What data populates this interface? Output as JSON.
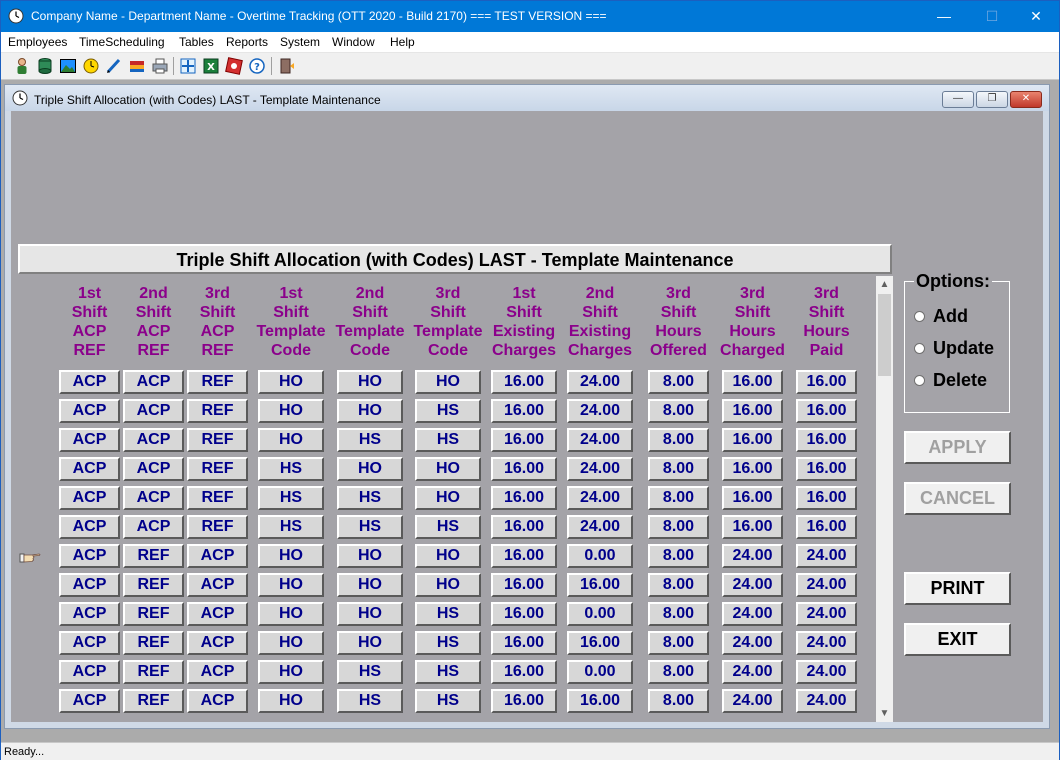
{
  "app": {
    "title": "Company Name - Department Name - Overtime Tracking (OTT 2020 - Build 2170)  === TEST VERSION ===",
    "window_controls": {
      "minimize": "—",
      "maximize": "☐",
      "close": "✕"
    }
  },
  "menu": [
    "Employees",
    "TimeScheduling",
    "Tables",
    "Reports",
    "System",
    "Window",
    "Help"
  ],
  "toolbar": {
    "icons": [
      "employee-icon",
      "database-icon",
      "image-icon",
      "clock-icon",
      "pencil-icon",
      "books-icon",
      "printer-icon",
      "expand-icon",
      "excel-icon",
      "badge-icon",
      "help-icon",
      "exit-door-icon"
    ]
  },
  "child_window": {
    "title": "Triple Shift Allocation (with Codes) LAST - Template Maintenance",
    "controls": {
      "minimize": "—",
      "restore": "❐",
      "close": "✕"
    }
  },
  "form": {
    "heading": "Triple Shift Allocation (with Codes) LAST - Template Maintenance",
    "columns": [
      [
        "1st",
        "Shift",
        "ACP",
        "REF"
      ],
      [
        "2nd",
        "Shift",
        "ACP",
        "REF"
      ],
      [
        "3rd",
        "Shift",
        "ACP",
        "REF"
      ],
      [
        "1st",
        "Shift",
        "Template",
        "Code"
      ],
      [
        "2nd",
        "Shift",
        "Template",
        "Code"
      ],
      [
        "3rd",
        "Shift",
        "Template",
        "Code"
      ],
      [
        "1st",
        "Shift",
        "Existing",
        "Charges"
      ],
      [
        "2nd",
        "Shift",
        "Existing",
        "Charges"
      ],
      [
        "3rd",
        "Shift",
        "Hours",
        "Offered"
      ],
      [
        "3rd",
        "Shift",
        "Hours",
        "Charged"
      ],
      [
        "3rd",
        "Shift",
        "Hours",
        "Paid"
      ]
    ],
    "rows": [
      [
        "ACP",
        "ACP",
        "REF",
        "HO",
        "HO",
        "HO",
        "16.00",
        "24.00",
        "8.00",
        "16.00",
        "16.00"
      ],
      [
        "ACP",
        "ACP",
        "REF",
        "HO",
        "HO",
        "HS",
        "16.00",
        "24.00",
        "8.00",
        "16.00",
        "16.00"
      ],
      [
        "ACP",
        "ACP",
        "REF",
        "HO",
        "HS",
        "HS",
        "16.00",
        "24.00",
        "8.00",
        "16.00",
        "16.00"
      ],
      [
        "ACP",
        "ACP",
        "REF",
        "HS",
        "HO",
        "HO",
        "16.00",
        "24.00",
        "8.00",
        "16.00",
        "16.00"
      ],
      [
        "ACP",
        "ACP",
        "REF",
        "HS",
        "HS",
        "HO",
        "16.00",
        "24.00",
        "8.00",
        "16.00",
        "16.00"
      ],
      [
        "ACP",
        "ACP",
        "REF",
        "HS",
        "HS",
        "HS",
        "16.00",
        "24.00",
        "8.00",
        "16.00",
        "16.00"
      ],
      [
        "ACP",
        "REF",
        "ACP",
        "HO",
        "HO",
        "HO",
        "16.00",
        "0.00",
        "8.00",
        "24.00",
        "24.00"
      ],
      [
        "ACP",
        "REF",
        "ACP",
        "HO",
        "HO",
        "HO",
        "16.00",
        "16.00",
        "8.00",
        "24.00",
        "24.00"
      ],
      [
        "ACP",
        "REF",
        "ACP",
        "HO",
        "HO",
        "HS",
        "16.00",
        "0.00",
        "8.00",
        "24.00",
        "24.00"
      ],
      [
        "ACP",
        "REF",
        "ACP",
        "HO",
        "HO",
        "HS",
        "16.00",
        "16.00",
        "8.00",
        "24.00",
        "24.00"
      ],
      [
        "ACP",
        "REF",
        "ACP",
        "HO",
        "HS",
        "HS",
        "16.00",
        "0.00",
        "8.00",
        "24.00",
        "24.00"
      ],
      [
        "ACP",
        "REF",
        "ACP",
        "HO",
        "HS",
        "HS",
        "16.00",
        "16.00",
        "8.00",
        "24.00",
        "24.00"
      ]
    ],
    "current_row_indicator": "pointing-hand-icon"
  },
  "options": {
    "legend": "Options:",
    "choices": [
      "Add",
      "Update",
      "Delete"
    ]
  },
  "buttons": {
    "apply": "APPLY",
    "cancel": "CANCEL",
    "print": "PRINT",
    "exit": "EXIT"
  },
  "status": "Ready..."
}
